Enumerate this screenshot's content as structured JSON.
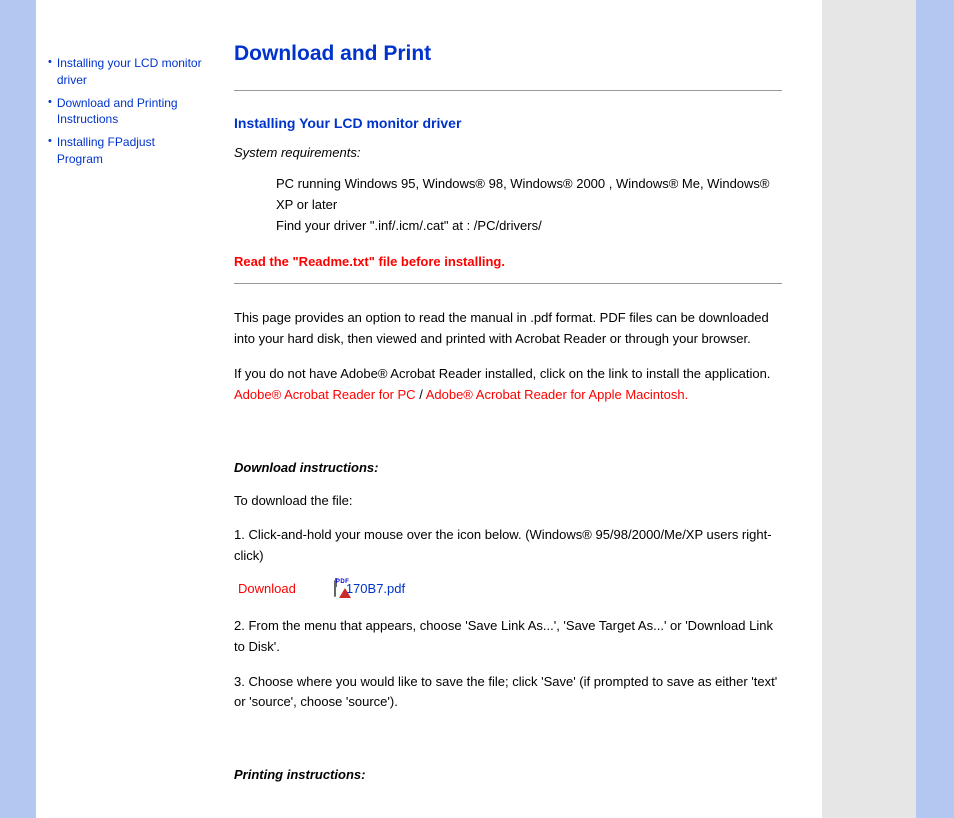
{
  "sidebar": {
    "links": [
      {
        "label": "Installing your LCD monitor driver"
      },
      {
        "label": "Download and Printing Instructions"
      },
      {
        "label": "Installing FPadjust Program"
      }
    ]
  },
  "title": "Download and Print",
  "section1": {
    "heading": "Installing Your LCD monitor driver",
    "req_label": "System requirements:",
    "req_line1": "PC running Windows 95, Windows® 98, Windows® 2000 , Windows® Me, Windows® XP or later",
    "req_line2": "Find your driver \".inf/.icm/.cat\" at : /PC/drivers/",
    "warning": "Read the \"Readme.txt\" file before installing."
  },
  "intro": {
    "p1": "This page provides an option to read the manual in .pdf format. PDF files can be downloaded into your hard disk, then viewed and printed with Acrobat Reader or through your browser.",
    "p2": "If you do not have Adobe® Acrobat Reader installed, click on the link to install the application.",
    "link_pc": "Adobe® Acrobat Reader for PC",
    "link_sep": " / ",
    "link_mac": "Adobe® Acrobat Reader for Apple Macintosh."
  },
  "download": {
    "heading": "Download instructions:",
    "intro": "To download the file:",
    "step1": "1. Click-and-hold your mouse over the icon below. (Windows® 95/98/2000/Me/XP users right-click)",
    "label": "Download",
    "pdf_name": "170B7.pdf",
    "step2": "2. From the menu that appears, choose 'Save Link As...', 'Save Target As...' or 'Download Link to Disk'.",
    "step3": "3. Choose where you would like to save the file; click 'Save' (if prompted to save as either 'text' or 'source', choose 'source')."
  },
  "print": {
    "heading": "Printing instructions:"
  }
}
